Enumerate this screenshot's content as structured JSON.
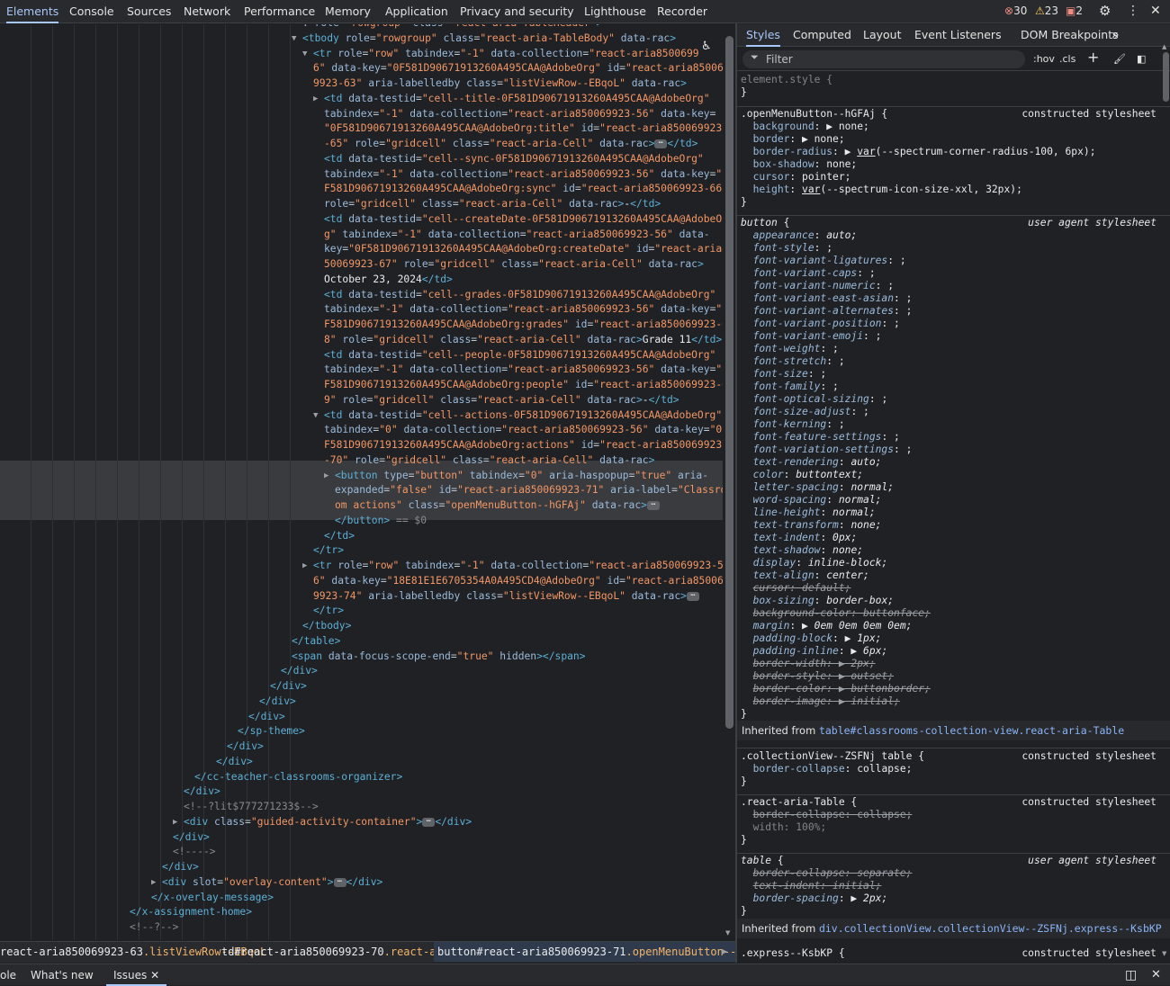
{
  "topbar": {
    "tabs": [
      "Elements",
      "Console",
      "Sources",
      "Network",
      "Performance",
      "Memory",
      "Application",
      "Privacy and security",
      "Lighthouse",
      "Recorder"
    ],
    "active_tab": "Elements",
    "errors": "30",
    "warnings": "23",
    "issues": "2"
  },
  "dom_lines": [
    {
      "indent": 28,
      "html": "<span class='t-attr'>.</span> <span class='t-attr'>role</span>=<span class='t-val'>\"rowgroup\"</span> <span class='t-attr'>class</span>=<span class='t-val'>\"react-aria-TableHeader\"</span><span class='t-tag'>&gt;</span>"
    },
    {
      "indent": 28,
      "arrow": "▼",
      "html": "<span class='t-tag'>&lt;tbody</span> <span class='t-attr'>role</span>=<span class='t-val'>\"rowgroup\"</span> <span class='t-attr'>class</span>=<span class='t-val'>\"react-aria-TableBody\"</span> <span class='t-attr'>data-rac</span><span class='t-tag'>&gt;</span>"
    },
    {
      "indent": 29,
      "arrow": "▼",
      "html": "<span class='t-tag'>&lt;tr</span> <span class='t-attr'>role</span>=<span class='t-val'>\"row\"</span> <span class='t-attr'>tabindex</span>=<span class='t-val'>\"-1\"</span> <span class='t-attr'>data-collection</span>=<span class='t-val'>\"react-aria8500699</span>"
    },
    {
      "indent": 29,
      "html": "<span class='t-val'>6\"</span> <span class='t-attr'>data-key</span>=<span class='t-val'>\"0F581D90671913260A495CAA@AdobeOrg\"</span> <span class='t-attr'>id</span>=<span class='t-val'>\"react-aria85006</span>"
    },
    {
      "indent": 29,
      "html": "<span class='t-val'>9923-63\"</span> <span class='t-attr'>aria-labelledby</span> <span class='t-attr'>class</span>=<span class='t-val'>\"listViewRow--EBqoL\"</span> <span class='t-attr'>data-rac</span><span class='t-tag'>&gt;</span>"
    },
    {
      "indent": 30,
      "arrow": "▶",
      "html": "<span class='t-tag'>&lt;td</span> <span class='t-attr'>data-testid</span>=<span class='t-val'>\"cell--title-0F581D90671913260A495CAA@AdobeOrg\"</span>"
    },
    {
      "indent": 30,
      "html": "<span class='t-attr'>tabindex</span>=<span class='t-val'>\"-1\"</span> <span class='t-attr'>data-collection</span>=<span class='t-val'>\"react-aria850069923-56\"</span> <span class='t-attr'>data-key</span>="
    },
    {
      "indent": 30,
      "html": "<span class='t-val'>\"0F581D90671913260A495CAA@AdobeOrg:title\"</span> <span class='t-attr'>id</span>=<span class='t-val'>\"react-aria850069923</span>"
    },
    {
      "indent": 30,
      "html": "<span class='t-val'>-65\"</span> <span class='t-attr'>role</span>=<span class='t-val'>\"gridcell\"</span> <span class='t-attr'>class</span>=<span class='t-val'>\"react-aria-Cell\"</span> <span class='t-attr'>data-rac</span><span class='t-tag'>&gt;</span><span class='ellip'>⋯</span><span class='t-tag'>&lt;/td&gt;</span>"
    },
    {
      "indent": 30,
      "html": "<span class='t-tag'>&lt;td</span> <span class='t-attr'>data-testid</span>=<span class='t-val'>\"cell--sync-0F581D90671913260A495CAA@AdobeOrg\"</span>"
    },
    {
      "indent": 30,
      "html": "<span class='t-attr'>tabindex</span>=<span class='t-val'>\"-1\"</span> <span class='t-attr'>data-collection</span>=<span class='t-val'>\"react-aria850069923-56\"</span> <span class='t-attr'>data-key</span>=<span class='t-val'>\"0</span>"
    },
    {
      "indent": 30,
      "html": "<span class='t-val'>F581D90671913260A495CAA@AdobeOrg:sync\"</span> <span class='t-attr'>id</span>=<span class='t-val'>\"react-aria850069923-66\"</span>"
    },
    {
      "indent": 30,
      "html": "<span class='t-attr'>role</span>=<span class='t-val'>\"gridcell\"</span> <span class='t-attr'>class</span>=<span class='t-val'>\"react-aria-Cell\"</span> <span class='t-attr'>data-rac</span><span class='t-tag'>&gt;</span><span class='t-text'>-</span><span class='t-tag'>&lt;/td&gt;</span>"
    },
    {
      "indent": 30,
      "html": "<span class='t-tag'>&lt;td</span> <span class='t-attr'>data-testid</span>=<span class='t-val'>\"cell--createDate-0F581D90671913260A495CAA@AdobeOr</span>"
    },
    {
      "indent": 30,
      "html": "<span class='t-val'>g\"</span> <span class='t-attr'>tabindex</span>=<span class='t-val'>\"-1\"</span> <span class='t-attr'>data-collection</span>=<span class='t-val'>\"react-aria850069923-56\"</span> <span class='t-attr'>data-</span>"
    },
    {
      "indent": 30,
      "html": "<span class='t-attr'>key</span>=<span class='t-val'>\"0F581D90671913260A495CAA@AdobeOrg:createDate\"</span> <span class='t-attr'>id</span>=<span class='t-val'>\"react-aria8</span>"
    },
    {
      "indent": 30,
      "html": "<span class='t-val'>50069923-67\"</span> <span class='t-attr'>role</span>=<span class='t-val'>\"gridcell\"</span> <span class='t-attr'>class</span>=<span class='t-val'>\"react-aria-Cell\"</span> <span class='t-attr'>data-rac</span><span class='t-tag'>&gt;</span>"
    },
    {
      "indent": 30,
      "html": "<span class='t-text'>October 23, 2024</span><span class='t-tag'>&lt;/td&gt;</span>"
    },
    {
      "indent": 30,
      "html": "<span class='t-tag'>&lt;td</span> <span class='t-attr'>data-testid</span>=<span class='t-val'>\"cell--grades-0F581D90671913260A495CAA@AdobeOrg\"</span>"
    },
    {
      "indent": 30,
      "html": "<span class='t-attr'>tabindex</span>=<span class='t-val'>\"-1\"</span> <span class='t-attr'>data-collection</span>=<span class='t-val'>\"react-aria850069923-56\"</span> <span class='t-attr'>data-key</span>=<span class='t-val'>\"0</span>"
    },
    {
      "indent": 30,
      "html": "<span class='t-val'>F581D90671913260A495CAA@AdobeOrg:grades\"</span> <span class='t-attr'>id</span>=<span class='t-val'>\"react-aria850069923-6</span>"
    },
    {
      "indent": 30,
      "html": "<span class='t-val'>8\"</span> <span class='t-attr'>role</span>=<span class='t-val'>\"gridcell\"</span> <span class='t-attr'>class</span>=<span class='t-val'>\"react-aria-Cell\"</span> <span class='t-attr'>data-rac</span><span class='t-tag'>&gt;</span><span class='t-text'>Grade 11</span><span class='t-tag'>&lt;/td&gt;</span>"
    },
    {
      "indent": 30,
      "html": "<span class='t-tag'>&lt;td</span> <span class='t-attr'>data-testid</span>=<span class='t-val'>\"cell--people-0F581D90671913260A495CAA@AdobeOrg\"</span>"
    },
    {
      "indent": 30,
      "html": "<span class='t-attr'>tabindex</span>=<span class='t-val'>\"-1\"</span> <span class='t-attr'>data-collection</span>=<span class='t-val'>\"react-aria850069923-56\"</span> <span class='t-attr'>data-key</span>=<span class='t-val'>\"0</span>"
    },
    {
      "indent": 30,
      "html": "<span class='t-val'>F581D90671913260A495CAA@AdobeOrg:people\"</span> <span class='t-attr'>id</span>=<span class='t-val'>\"react-aria850069923-6</span>"
    },
    {
      "indent": 30,
      "html": "<span class='t-val'>9\"</span> <span class='t-attr'>role</span>=<span class='t-val'>\"gridcell\"</span> <span class='t-attr'>class</span>=<span class='t-val'>\"react-aria-Cell\"</span> <span class='t-attr'>data-rac</span><span class='t-tag'>&gt;</span><span class='t-text'>-</span><span class='t-tag'>&lt;/td&gt;</span>"
    },
    {
      "indent": 30,
      "arrow": "▼",
      "html": "<span class='t-tag'>&lt;td</span> <span class='t-attr'>data-testid</span>=<span class='t-val'>\"cell--actions-0F581D90671913260A495CAA@AdobeOrg\"</span>"
    },
    {
      "indent": 30,
      "html": "<span class='t-attr'>tabindex</span>=<span class='t-val'>\"0\"</span> <span class='t-attr'>data-collection</span>=<span class='t-val'>\"react-aria850069923-56\"</span> <span class='t-attr'>data-key</span>=<span class='t-val'>\"0</span>"
    },
    {
      "indent": 30,
      "html": "<span class='t-val'>F581D90671913260A495CAA@AdobeOrg:actions\"</span> <span class='t-attr'>id</span>=<span class='t-val'>\"react-aria850069923</span>"
    },
    {
      "indent": 30,
      "html": "<span class='t-val'>-70\"</span> <span class='t-attr'>role</span>=<span class='t-val'>\"gridcell\"</span> <span class='t-attr'>class</span>=<span class='t-val'>\"react-aria-Cell\"</span> <span class='t-attr'>data-rac</span><span class='t-tag'>&gt;</span>"
    },
    {
      "indent": 31,
      "arrow": "▶",
      "html": "<span class='t-tag'>&lt;button</span> <span class='t-attr'>type</span>=<span class='t-val'>\"button\"</span> <span class='t-attr'>tabindex</span>=<span class='t-val'>\"0\"</span> <span class='t-attr'>aria-haspopup</span>=<span class='t-val'>\"true\"</span> <span class='t-attr'>aria-</span>"
    },
    {
      "indent": 31,
      "html": "<span class='t-attr'>expanded</span>=<span class='t-val'>\"false\"</span> <span class='t-attr'>id</span>=<span class='t-val'>\"react-aria850069923-71\"</span> <span class='t-attr'>aria-label</span>=<span class='t-val'>\"Classro</span>"
    },
    {
      "indent": 31,
      "html": "<span class='t-val'>om actions\"</span> <span class='t-attr'>class</span>=<span class='t-val'>\"openMenuButton--hGFAj\"</span> <span class='t-attr'>data-rac</span><span class='t-tag'>&gt;</span><span class='ellip'>⋯</span>"
    },
    {
      "indent": 31,
      "html": "<span class='t-tag'>&lt;/button&gt;</span> <span class='t-comment'>== $0</span>"
    },
    {
      "indent": 30,
      "html": "<span class='t-tag'>&lt;/td&gt;</span>"
    },
    {
      "indent": 29,
      "html": "<span class='t-tag'>&lt;/tr&gt;</span>"
    },
    {
      "indent": 29,
      "arrow": "▶",
      "html": "<span class='t-tag'>&lt;tr</span> <span class='t-attr'>role</span>=<span class='t-val'>\"row\"</span> <span class='t-attr'>tabindex</span>=<span class='t-val'>\"-1\"</span> <span class='t-attr'>data-collection</span>=<span class='t-val'>\"react-aria850069923-5</span>"
    },
    {
      "indent": 29,
      "html": "<span class='t-val'>6\"</span> <span class='t-attr'>data-key</span>=<span class='t-val'>\"18E81E1E6705354A0A495CD4@AdobeOrg\"</span> <span class='t-attr'>id</span>=<span class='t-val'>\"react-aria85006</span>"
    },
    {
      "indent": 29,
      "html": "<span class='t-val'>9923-74\"</span> <span class='t-attr'>aria-labelledby</span> <span class='t-attr'>class</span>=<span class='t-val'>\"listViewRow--EBqoL\"</span> <span class='t-attr'>data-rac</span><span class='t-tag'>&gt;</span><span class='ellip'>⋯</span>"
    },
    {
      "indent": 29,
      "html": "<span class='t-tag'>&lt;/tr&gt;</span>"
    },
    {
      "indent": 28,
      "html": "<span class='t-tag'>&lt;/tbody&gt;</span>"
    },
    {
      "indent": 27,
      "html": "<span class='t-tag'>&lt;/table&gt;</span>"
    },
    {
      "indent": 27,
      "html": "<span class='t-tag'>&lt;span</span> <span class='t-attr'>data-focus-scope-end</span>=<span class='t-val'>\"true\"</span> <span class='t-attr'>hidden</span><span class='t-tag'>&gt;&lt;/span&gt;</span>"
    },
    {
      "indent": 26,
      "html": "<span class='t-tag'>&lt;/div&gt;</span>"
    },
    {
      "indent": 25,
      "html": "<span class='t-tag'>&lt;/div&gt;</span>"
    },
    {
      "indent": 24,
      "html": "<span class='t-tag'>&lt;/div&gt;</span>"
    },
    {
      "indent": 23,
      "html": "<span class='t-tag'>&lt;/div&gt;</span>"
    },
    {
      "indent": 22,
      "html": "<span class='t-tag'>&lt;/sp-theme&gt;</span>"
    },
    {
      "indent": 21,
      "html": "<span class='t-tag'>&lt;/div&gt;</span>"
    },
    {
      "indent": 20,
      "html": "<span class='t-tag'>&lt;/div&gt;</span>"
    },
    {
      "indent": 18,
      "html": "<span class='t-tag'>&lt;/cc-teacher-classrooms-organizer&gt;</span>"
    },
    {
      "indent": 17,
      "html": "<span class='t-tag'>&lt;/div&gt;</span>"
    },
    {
      "indent": 17,
      "html": "<span class='t-comment'>&lt;!--?lit$777271233$--&gt;</span>"
    },
    {
      "indent": 17,
      "arrow": "▶",
      "html": "<span class='t-tag'>&lt;div</span> <span class='t-attr'>class</span>=<span class='t-val'>\"guided-activity-container\"</span><span class='t-tag'>&gt;</span><span class='ellip'>⋯</span><span class='t-tag'>&lt;/div&gt;</span>"
    },
    {
      "indent": 16,
      "html": "<span class='t-tag'>&lt;/div&gt;</span>"
    },
    {
      "indent": 16,
      "html": "<span class='t-comment'>&lt;!----&gt;</span>"
    },
    {
      "indent": 15,
      "html": "<span class='t-tag'>&lt;/div&gt;</span>"
    },
    {
      "indent": 15,
      "arrow": "▶",
      "html": "<span class='t-tag'>&lt;div</span> <span class='t-attr'>slot</span>=<span class='t-val'>\"overlay-content\"</span><span class='t-tag'>&gt;</span><span class='ellip'>⋯</span><span class='t-tag'>&lt;/div&gt;</span>"
    },
    {
      "indent": 14,
      "html": "<span class='t-tag'>&lt;/x-overlay-message&gt;</span>"
    },
    {
      "indent": 12,
      "html": "<span class='t-tag'>&lt;/x-assignment-home&gt;</span>"
    },
    {
      "indent": 12,
      "html": "<span class='t-comment'>&lt;!--?--&gt;</span>"
    }
  ],
  "breadcrumb": [
    {
      "tag": "react-aria850069923-63",
      "cls": ".listViewRow--EBqoL"
    },
    {
      "tag": "td#react-aria850069923-70",
      "cls": ".react-aria-Cell"
    },
    {
      "tag": "button#react-aria850069923-71",
      "cls": ".openMenuButton--hGFAj"
    }
  ],
  "styles_panel": {
    "tabs": [
      "Styles",
      "Computed",
      "Layout",
      "Event Listeners",
      "DOM Breakpoints"
    ],
    "active_tab": "Styles",
    "filter_placeholder": "Filter",
    "hov_label": ":hov",
    "cls_label": ".cls",
    "lines": [
      {
        "html": "<span class='dim'>element.style {</span>"
      },
      {
        "html": "}"
      },
      {
        "html": ".openMenuButton--hGFAj {",
        "origin": "constructed stylesheet",
        "sep": true
      },
      {
        "html": "  <span class='sp-prop'>background</span>: ▶ none;"
      },
      {
        "html": "  <span class='sp-prop'>border</span>: ▶ none;"
      },
      {
        "html": "  <span class='sp-prop'>border-radius</span>: ▶ <u>var</u>(--spectrum-corner-radius-100, 6px);"
      },
      {
        "html": "  <span class='sp-prop'>box-shadow</span>: none;"
      },
      {
        "html": "  <span class='sp-prop'>cursor</span>: pointer;"
      },
      {
        "html": "  <span class='sp-prop'>height</span>: <u>var</u>(--spectrum-icon-size-xxl, 32px);"
      },
      {
        "html": "}"
      },
      {
        "html": "<i>button</i> {",
        "origin": "user agent stylesheet",
        "ua": true,
        "sep": true
      },
      {
        "html": "  <span class='sp-ua'>appearance</span>: <i>auto;</i>"
      },
      {
        "html": "  <span class='sp-ua'>font-style</span>: ;"
      },
      {
        "html": "  <span class='sp-ua'>font-variant-ligatures</span>: ;"
      },
      {
        "html": "  <span class='sp-ua'>font-variant-caps</span>: ;"
      },
      {
        "html": "  <span class='sp-ua'>font-variant-numeric</span>: ;"
      },
      {
        "html": "  <span class='sp-ua'>font-variant-east-asian</span>: ;"
      },
      {
        "html": "  <span class='sp-ua'>font-variant-alternates</span>: ;"
      },
      {
        "html": "  <span class='sp-ua'>font-variant-position</span>: ;"
      },
      {
        "html": "  <span class='sp-ua'>font-variant-emoji</span>: ;"
      },
      {
        "html": "  <span class='sp-ua'>font-weight</span>: ;"
      },
      {
        "html": "  <span class='sp-ua'>font-stretch</span>: ;"
      },
      {
        "html": "  <span class='sp-ua'>font-size</span>: ;"
      },
      {
        "html": "  <span class='sp-ua'>font-family</span>: ;"
      },
      {
        "html": "  <span class='sp-ua'>font-optical-sizing</span>: ;"
      },
      {
        "html": "  <span class='sp-ua'>font-size-adjust</span>: ;"
      },
      {
        "html": "  <span class='sp-ua'>font-kerning</span>: ;"
      },
      {
        "html": "  <span class='sp-ua'>font-feature-settings</span>: ;"
      },
      {
        "html": "  <span class='sp-ua'>font-variation-settings</span>: ;"
      },
      {
        "html": "  <span class='sp-ua'>text-rendering</span>: <i>auto;</i>"
      },
      {
        "html": "  <span class='sp-ua'>color</span>: <i>buttontext;</i>"
      },
      {
        "html": "  <span class='sp-ua'>letter-spacing</span>: <i>normal;</i>"
      },
      {
        "html": "  <span class='sp-ua'>word-spacing</span>: <i>normal;</i>"
      },
      {
        "html": "  <span class='sp-ua'>line-height</span>: <i>normal;</i>"
      },
      {
        "html": "  <span class='sp-ua'>text-transform</span>: <i>none;</i>"
      },
      {
        "html": "  <span class='sp-ua'>text-indent</span>: <i>0px;</i>"
      },
      {
        "html": "  <span class='sp-ua'>text-shadow</span>: <i>none;</i>"
      },
      {
        "html": "  <span class='sp-ua'>display</span>: <i>inline-block;</i>"
      },
      {
        "html": "  <span class='sp-ua'>text-align</span>: <i>center;</i>"
      },
      {
        "html": "  <span class='strike'><i>cursor: default;</i></span>"
      },
      {
        "html": "  <span class='sp-ua'>box-sizing</span>: <i>border-box;</i>"
      },
      {
        "html": "  <span class='strike'><i>background-color: buttonface;</i></span>"
      },
      {
        "html": "  <span class='sp-ua'>margin</span>: ▶ <i>0em 0em 0em 0em;</i>"
      },
      {
        "html": "  <span class='sp-ua'>padding-block</span>: ▶ <i>1px;</i>"
      },
      {
        "html": "  <span class='sp-ua'>padding-inline</span>: ▶ <i>6px;</i>"
      },
      {
        "html": "  <span class='strike'><i>border-width: ▶ 2px;</i></span>"
      },
      {
        "html": "  <span class='strike'><i>border-style: ▶ outset;</i></span>"
      },
      {
        "html": "  <span class='strike'><i>border-color: ▶ buttonborder;</i></span>"
      },
      {
        "html": "  <span class='strike'><i>border-image: ▶ initial;</i></span>"
      },
      {
        "html": "}"
      },
      {
        "inherit": "Inherited from ",
        "link": "table#classrooms-collection-view.react-aria-Table"
      },
      {
        "html": ".collectionView--ZSFNj table {",
        "origin": "constructed stylesheet"
      },
      {
        "html": "  <span class='sp-prop'>border-collapse</span>: collapse;"
      },
      {
        "html": "}"
      },
      {
        "html": ".react-aria-Table {",
        "origin": "constructed stylesheet",
        "sep": true
      },
      {
        "html": "  <span class='strike'>border-collapse: collapse;</span>"
      },
      {
        "html": "  <span class='dim'>width: 100%;</span>"
      },
      {
        "html": "}"
      },
      {
        "html": "<i>table</i> {",
        "origin": "user agent stylesheet",
        "ua": true,
        "sep": true
      },
      {
        "html": "  <span class='strike'><i>border-collapse: separate;</i></span>"
      },
      {
        "html": "  <span class='strike'><i>text-indent: initial;</i></span>"
      },
      {
        "html": "  <span class='sp-ua'>border-spacing</span>: ▶ <i>2px;</i>"
      },
      {
        "html": "}"
      },
      {
        "inherit": "Inherited from ",
        "link": "div.collectionView.collectionView--ZSFNj.express--KsbKP"
      },
      {
        "html": ".express--KsbKP {",
        "origin": "constructed stylesheet"
      }
    ]
  },
  "drawer": {
    "tabs": [
      "ole",
      "What's new",
      "Issues"
    ],
    "active_tab": "Issues"
  }
}
